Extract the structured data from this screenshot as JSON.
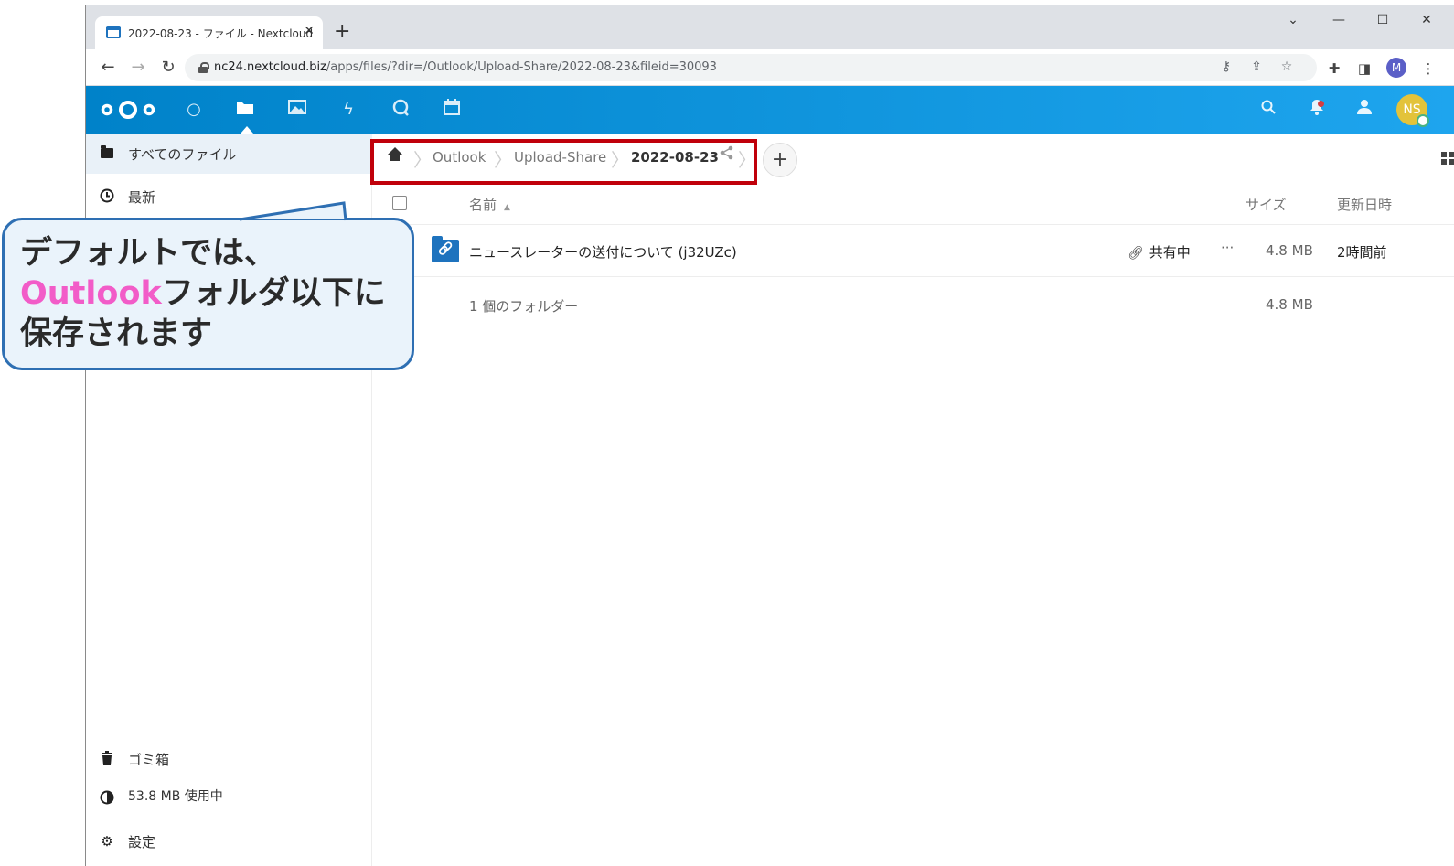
{
  "browser": {
    "tab_title": "2022-08-23 - ファイル - Nextcloud",
    "tab_close": "✕",
    "new_tab": "+",
    "window_controls": {
      "dropdown": "⌄",
      "minimize": "—",
      "maximize": "☐",
      "close": "✕"
    },
    "url_host": "nc24.nextcloud.biz",
    "url_path": "/apps/files/?dir=/Outlook/Upload-Share/2022-08-23&fileid=30093",
    "profile_initial": "M",
    "icons": [
      "key-icon",
      "share-icon",
      "star-icon",
      "extensions-icon",
      "side-panel-icon",
      "menu-icon"
    ]
  },
  "nextcloud": {
    "apps": [
      "dashboard-icon",
      "files-icon",
      "photos-icon",
      "activity-icon",
      "talk-icon",
      "calendar-icon"
    ],
    "avatar_initials": "NS",
    "accent_color": "#0082c9"
  },
  "sidebar": {
    "items": [
      {
        "label": "すべてのファイル",
        "icon": "folder-icon"
      },
      {
        "label": "最新",
        "icon": "clock-icon"
      }
    ],
    "bottom": {
      "trash_label": "ゴミ箱",
      "quota_label": "53.8 MB 使用中",
      "settings_label": "設定"
    }
  },
  "breadcrumb": {
    "items": [
      "Outlook",
      "Upload-Share",
      "2022-08-23"
    ],
    "add_label": "+"
  },
  "table": {
    "headers": {
      "name": "名前",
      "size": "サイズ",
      "modified": "更新日時"
    },
    "rows": [
      {
        "name": "ニュースレーターの送付について (j32UZc)",
        "share_label": "共有中",
        "more": "···",
        "size": "4.8 MB",
        "modified": "2時間前"
      }
    ],
    "summary": {
      "count_label": "1 個のフォルダー",
      "total_size": "4.8 MB"
    }
  },
  "callout": {
    "line1": "デフォルトでは、",
    "line2_accent": "Outlook",
    "line2_rest": "フォルダ以下に",
    "line3": "保存されます",
    "accent_color": "#f25cc8",
    "border_color": "#2e6fb3"
  },
  "highlight_color": "#c0000a"
}
